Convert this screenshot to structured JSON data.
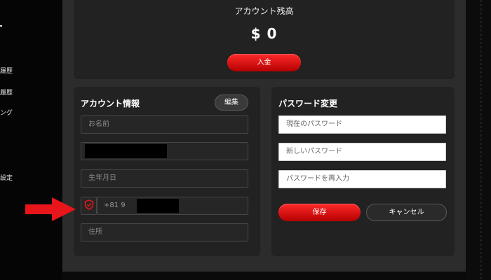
{
  "sidebar": {
    "items": [
      {
        "label": "履歴"
      },
      {
        "label": "履歴"
      },
      {
        "label": "ング"
      },
      {
        "label": "設定"
      }
    ]
  },
  "balance": {
    "title": "アカウント残高",
    "amount": "$ 0",
    "deposit_label": "入金"
  },
  "account_info": {
    "title": "アカウント情報",
    "edit_label": "編集",
    "name_placeholder": "お名前",
    "birthdate_placeholder": "生年月日",
    "phone_prefix": "+81 9",
    "address_placeholder": "住所"
  },
  "password": {
    "title": "パスワード変更",
    "current_placeholder": "現在のパスワード",
    "new_placeholder": "新しいパスワード",
    "confirm_placeholder": "パスワードを再入力",
    "save_label": "保存",
    "cancel_label": "キャンセル"
  },
  "colors": {
    "accent_red": "#e00000",
    "panel": "#2c2c2c",
    "card": "#222222"
  },
  "icons": {
    "verify": "shield-check-icon",
    "pointer": "red-arrow-icon"
  }
}
